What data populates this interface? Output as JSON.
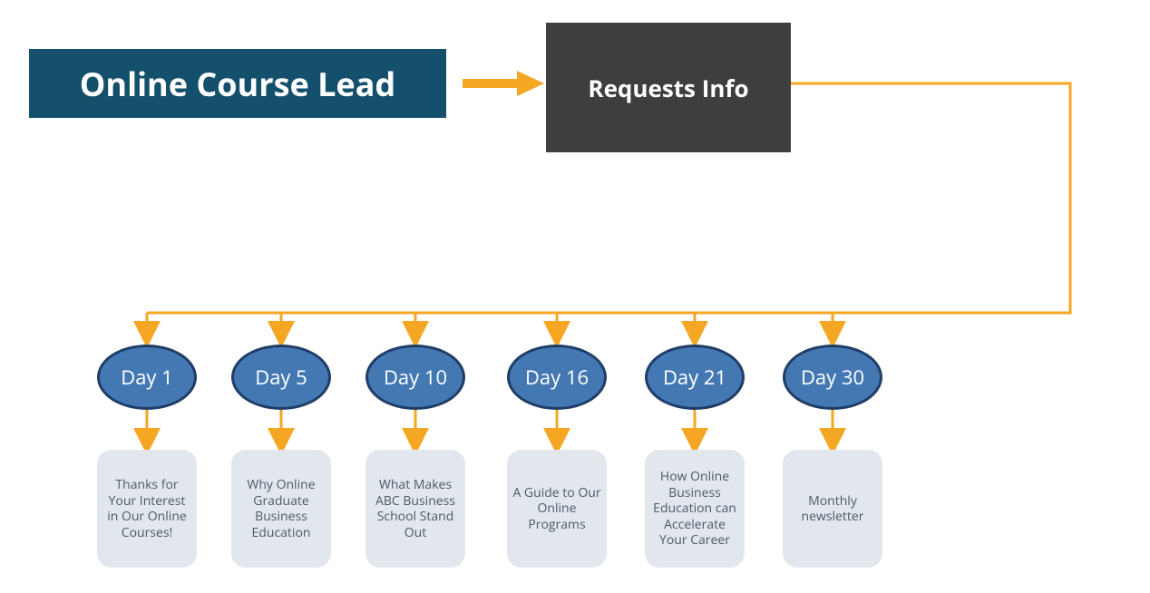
{
  "header": {
    "lead_label": "Online Course Lead",
    "requests_label": "Requests Info"
  },
  "colors": {
    "lead_bg": "#14506b",
    "requests_bg": "#3e3e3e",
    "arrow": "#f5a623",
    "ellipse_fill": "#4478b3",
    "ellipse_stroke": "#1f3d66",
    "card_bg": "#e2e7ed",
    "card_text": "#4a5a68"
  },
  "steps": [
    {
      "day_label": "Day 1",
      "card_text": "Thanks for Your Interest in Our Online Courses!"
    },
    {
      "day_label": "Day 5",
      "card_text": "Why Online Graduate Business Education"
    },
    {
      "day_label": "Day 10",
      "card_text": "What Makes ABC Business School Stand Out"
    },
    {
      "day_label": "Day 16",
      "card_text": "A Guide to Our Online Programs"
    },
    {
      "day_label": "Day 21",
      "card_text": "How Online Business Education can Accelerate Your Career"
    },
    {
      "day_label": "Day 30",
      "card_text": "Monthly newsletter"
    }
  ]
}
